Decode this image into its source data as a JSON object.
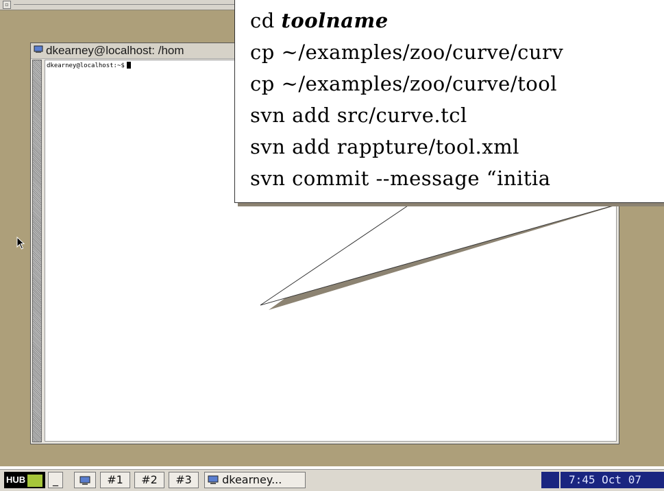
{
  "top_bar": {
    "button_glyph": "▫"
  },
  "terminal": {
    "title": "dkearney@localhost: /hom",
    "prompt": "dkearney@localhost:~$",
    "title_icon": "terminal-icon"
  },
  "callout": {
    "lines": [
      {
        "prefix": "cd ",
        "emph": "toolname",
        "rest": ""
      },
      {
        "prefix": "cp ~/examples/zoo/curve/curv",
        "emph": "",
        "rest": ""
      },
      {
        "prefix": "cp ~/examples/zoo/curve/tool",
        "emph": "",
        "rest": ""
      },
      {
        "prefix": "svn add src/curve.tcl",
        "emph": "",
        "rest": ""
      },
      {
        "prefix": "svn add rappture/tool.xml",
        "emph": "",
        "rest": ""
      },
      {
        "prefix": "svn commit --message “initia",
        "emph": "",
        "rest": ""
      }
    ]
  },
  "taskbar": {
    "logo_text": "HUB",
    "minimize_label": "_",
    "desktops": [
      "#1",
      "#2",
      "#3"
    ],
    "window_button_label": "dkearney...",
    "clock": "7:45 Oct 07"
  },
  "colors": {
    "desktop": "#ad9f7a",
    "clock_bg": "#1a2580",
    "logo_accent": "#a6c63a"
  }
}
